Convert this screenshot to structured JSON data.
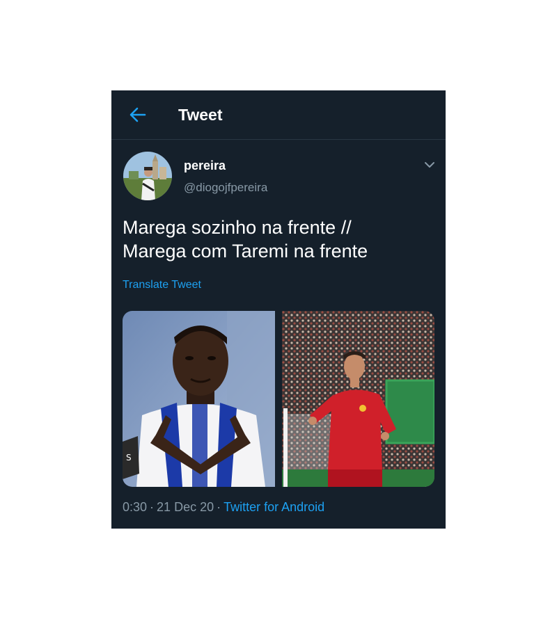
{
  "header": {
    "title": "Tweet",
    "back_icon": "arrow-left-icon"
  },
  "tweet": {
    "display_name": "pereira",
    "handle": "@diogojfpereira",
    "text": "Marega sozinho na frente //\nMarega com Taremi na frente",
    "translate_label": "Translate Tweet",
    "time": "0:30",
    "date": "21 Dec 20",
    "separator": "·",
    "source": "Twitter for Android"
  },
  "colors": {
    "background": "#15202b",
    "accent": "#1da1f2",
    "secondary_text": "#8899a6"
  }
}
